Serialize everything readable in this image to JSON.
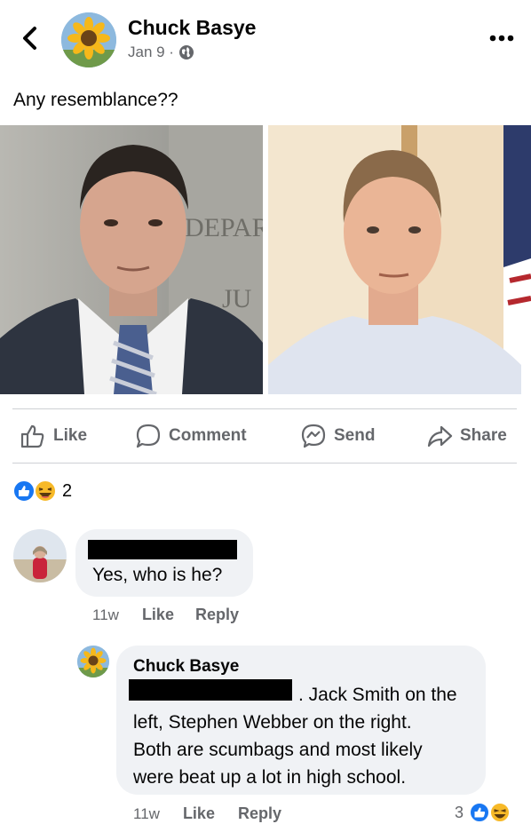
{
  "post": {
    "author": "Chuck Basye",
    "date": "Jan 9 ·",
    "text": "Any resemblance??",
    "photo_left_label": "DEPAR\nJU"
  },
  "actions": {
    "like": "Like",
    "comment": "Comment",
    "send": "Send",
    "share": "Share"
  },
  "reactions": {
    "count": "2"
  },
  "comments": [
    {
      "text": "Yes, who is he?",
      "time": "11w",
      "like": "Like",
      "reply": "Reply"
    },
    {
      "author": "Chuck Basye",
      "text_lines": [
        ". Jack Smith on the",
        "left, Stephen Webber on the right.",
        "Both are scumbags and most likely",
        "were beat up a lot in high school."
      ],
      "time": "11w",
      "like": "Like",
      "reply": "Reply",
      "reaction_count": "3"
    }
  ],
  "colors": {
    "secondary_text": "#65676b",
    "bubble": "#f0f2f5",
    "like_blue": "#1877f2",
    "haha_yellow": "#f7b928"
  }
}
